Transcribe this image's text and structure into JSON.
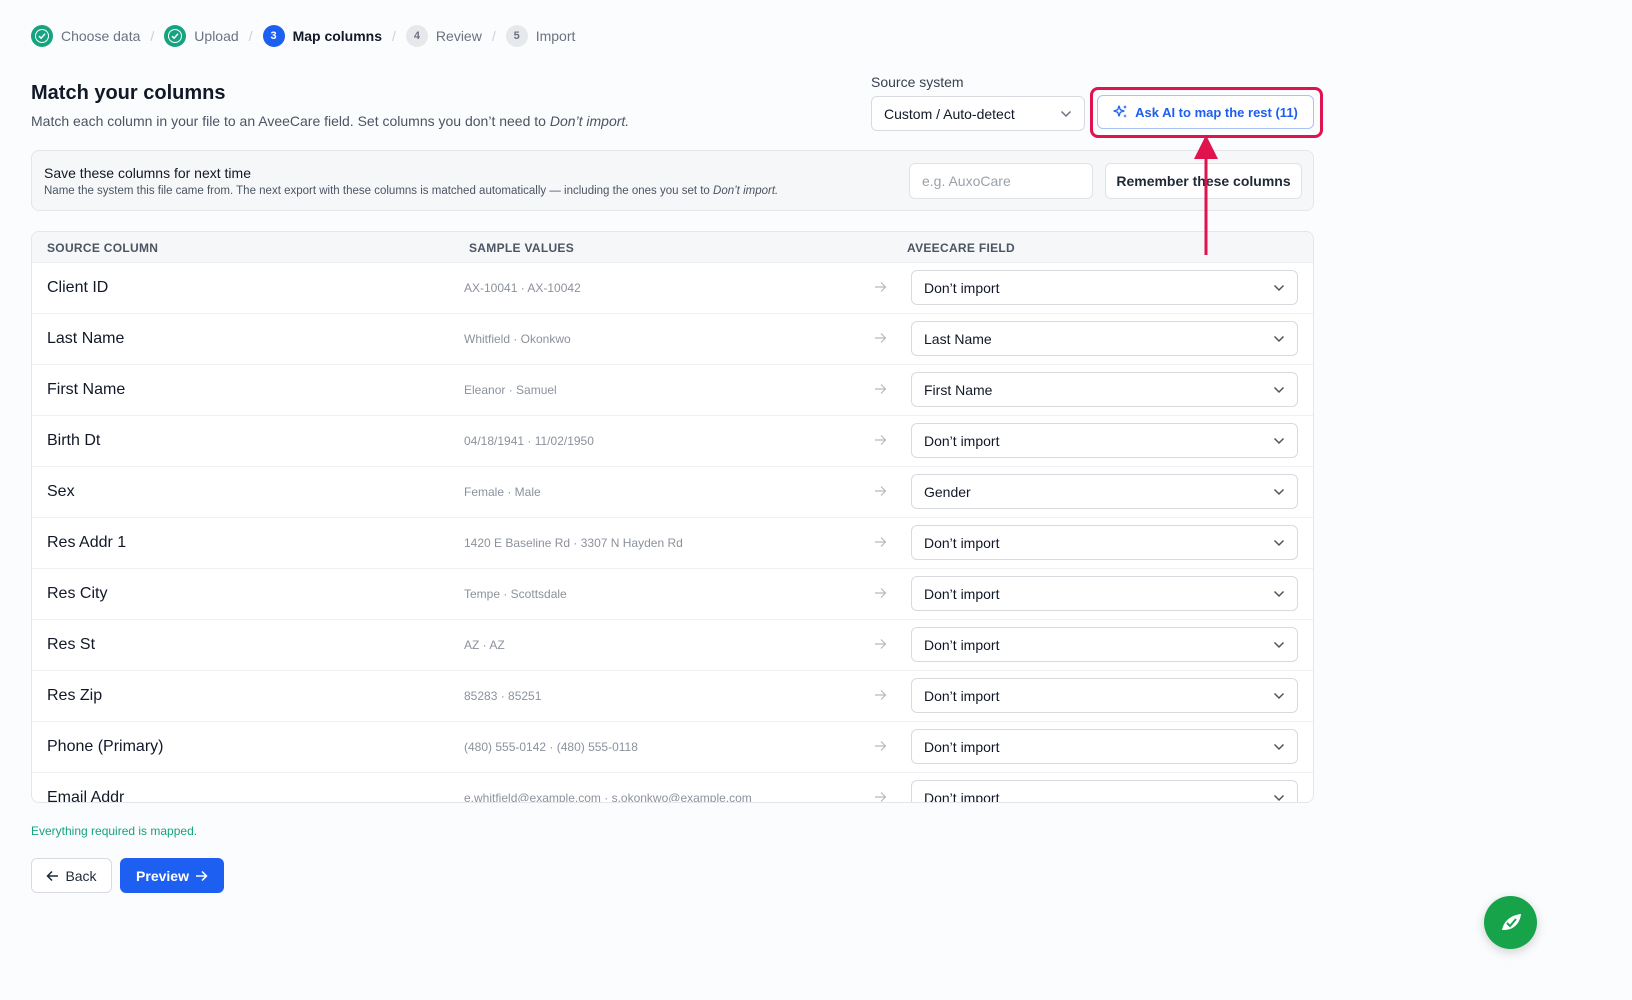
{
  "stepper": {
    "steps": [
      {
        "number": "",
        "label": "Choose data",
        "state": "done"
      },
      {
        "number": "",
        "label": "Upload",
        "state": "done"
      },
      {
        "number": "3",
        "label": "Map columns",
        "state": "active"
      },
      {
        "number": "4",
        "label": "Review",
        "state": "pending"
      },
      {
        "number": "5",
        "label": "Import",
        "state": "pending"
      }
    ],
    "separator": "/"
  },
  "header": {
    "title": "Match your columns",
    "subtitle_prefix": "Match each column in your file to an AveeCare field. Set columns you don’t need to",
    "subtitle_em": "Don’t import."
  },
  "source_system": {
    "label": "Source system",
    "value": "Custom / Auto-detect"
  },
  "ai_button": {
    "label": "Ask AI to map the rest (11)"
  },
  "save_panel": {
    "title": "Save these columns for next time",
    "subtitle_prefix": "Name the system this file came from. The next export with these columns is matched automatically — including the ones you set to",
    "subtitle_em": "Don’t import.",
    "input_placeholder": "e.g. AuxoCare",
    "button_label": "Remember these columns"
  },
  "table": {
    "headers": [
      "SOURCE COLUMN",
      "SAMPLE VALUES",
      "AVEECARE FIELD"
    ],
    "rows": [
      {
        "source": "Client ID",
        "sample": "AX-10041 · AX-10042",
        "field": "Don’t import"
      },
      {
        "source": "Last Name",
        "sample": "Whitfield · Okonkwo",
        "field": "Last Name"
      },
      {
        "source": "First Name",
        "sample": "Eleanor · Samuel",
        "field": "First Name"
      },
      {
        "source": "Birth Dt",
        "sample": "04/18/1941 · 11/02/1950",
        "field": "Don’t import"
      },
      {
        "source": "Sex",
        "sample": "Female · Male",
        "field": "Gender"
      },
      {
        "source": "Res Addr 1",
        "sample": "1420 E Baseline Rd · 3307 N Hayden Rd",
        "field": "Don’t import"
      },
      {
        "source": "Res City",
        "sample": "Tempe · Scottsdale",
        "field": "Don’t import"
      },
      {
        "source": "Res St",
        "sample": "AZ · AZ",
        "field": "Don’t import"
      },
      {
        "source": "Res Zip",
        "sample": "85283 · 85251",
        "field": "Don’t import"
      },
      {
        "source": "Phone (Primary)",
        "sample": "(480) 555-0142 · (480) 555-0118",
        "field": "Don’t import"
      },
      {
        "source": "Email Addr",
        "sample": "e.whitfield@example.com · s.okonkwo@example.com",
        "field": "Don’t import"
      }
    ]
  },
  "status": "Everything required is mapped.",
  "footer": {
    "back_label": "Back",
    "preview_label": "Preview"
  },
  "colors": {
    "accent": "#1d5ff0",
    "success": "#16a37f",
    "highlight": "#e0134f",
    "fab": "#16a34a"
  }
}
